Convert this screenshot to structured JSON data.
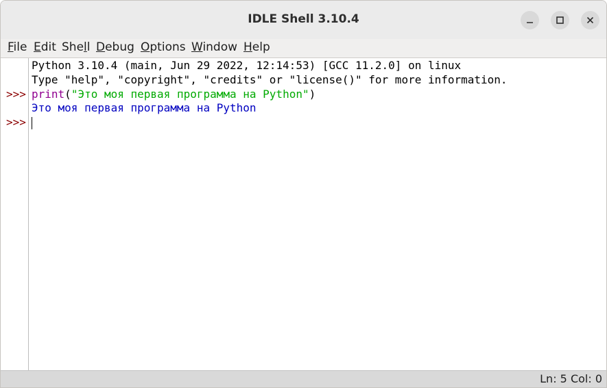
{
  "window": {
    "title": "IDLE Shell 3.10.4",
    "controls": [
      "minimize-icon",
      "maximize-icon",
      "close-icon"
    ]
  },
  "menu": {
    "file": {
      "u": "F",
      "rest": "ile"
    },
    "edit": {
      "u": "E",
      "rest": "dit"
    },
    "shell": {
      "pre": "She",
      "u": "l",
      "rest": "l"
    },
    "debug": {
      "u": "D",
      "rest": "ebug"
    },
    "options": {
      "u": "O",
      "rest": "ptions"
    },
    "window": {
      "u": "W",
      "rest": "indow"
    },
    "help": {
      "u": "H",
      "rest": "elp"
    }
  },
  "shell": {
    "banner_line1": "Python 3.10.4 (main, Jun 29 2022, 12:14:53) [GCC 11.2.0] on linux",
    "banner_line2": "Type \"help\", \"copyright\", \"credits\" or \"license()\" for more information.",
    "prompt": ">>>",
    "input": {
      "func": "print",
      "open_paren": "(",
      "string": "\"Это моя первая программа на Python\"",
      "close_paren": ")"
    },
    "output": "Это моя первая программа на Python"
  },
  "status": {
    "position": "Ln: 5 Col: 0"
  },
  "colors": {
    "prompt": "#8b0000",
    "builtin": "#900090",
    "string": "#00aa00",
    "output": "#0000c0"
  }
}
